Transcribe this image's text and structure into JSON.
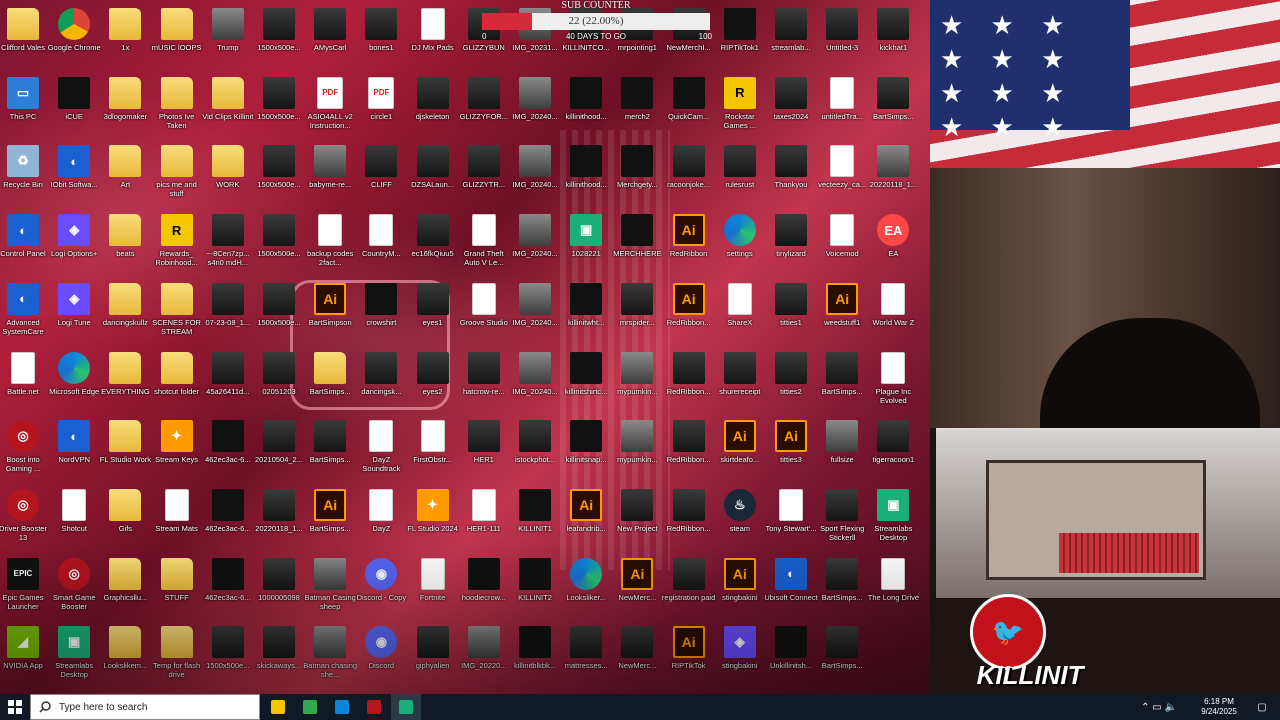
{
  "sub_counter": {
    "title": "SUB COUNTER",
    "current": 22,
    "percent_label": "22 (22.00%)",
    "progress_fraction": 0.22,
    "min_label": "0",
    "max_label": "100",
    "days_label": "40 DAYS TO GO"
  },
  "desktop_icons": [
    {
      "label": "Clifford Vales",
      "type": "folder"
    },
    {
      "label": "Google Chrome",
      "type": "chrome"
    },
    {
      "label": "1x",
      "type": "folder"
    },
    {
      "label": "mUSIC lOOPS",
      "type": "folder"
    },
    {
      "label": "Trump",
      "type": "photo"
    },
    {
      "label": "1500x500e...",
      "type": "img"
    },
    {
      "label": "AMysCarl",
      "type": "img"
    },
    {
      "label": "bones1",
      "type": "img"
    },
    {
      "label": "DJ Mix Pads",
      "type": "file"
    },
    {
      "label": "GLIZZYBUN",
      "type": "img"
    },
    {
      "label": "IMG_20231...",
      "type": "photo"
    },
    {
      "label": "KILLINITCO...",
      "type": "img"
    },
    {
      "label": "mrpointing1",
      "type": "img"
    },
    {
      "label": "NewMerchI...",
      "type": "img"
    },
    {
      "label": "RIPTikTok1",
      "type": "dark"
    },
    {
      "label": "streamlab...",
      "type": "img"
    },
    {
      "label": "Untitled-3",
      "type": "img"
    },
    {
      "label": "kickhat1",
      "type": "img"
    },
    {
      "label": "This PC",
      "type": "pc"
    },
    {
      "label": "iCUE",
      "type": "dark"
    },
    {
      "label": "3dlogomaker",
      "type": "folder"
    },
    {
      "label": "Photos Ive Taken",
      "type": "folder"
    },
    {
      "label": "Vid Clips Killinit",
      "type": "folder"
    },
    {
      "label": "1500x500e...",
      "type": "img"
    },
    {
      "label": "ASIO4ALL v2 Instruction...",
      "type": "pdf"
    },
    {
      "label": "circle1",
      "type": "pdf"
    },
    {
      "label": "djskeleton",
      "type": "img"
    },
    {
      "label": "GLIZZYFOR...",
      "type": "img"
    },
    {
      "label": "IMG_20240...",
      "type": "photo"
    },
    {
      "label": "killinithood...",
      "type": "dark"
    },
    {
      "label": "merch2",
      "type": "dark"
    },
    {
      "label": "QuickCam...",
      "type": "dark"
    },
    {
      "label": "Rockstar Games ...",
      "type": "yellow"
    },
    {
      "label": "taxes2024",
      "type": "img"
    },
    {
      "label": "untitledTra...",
      "type": "file"
    },
    {
      "label": "BartSimps...",
      "type": "img"
    },
    {
      "label": "Recycle Bin",
      "type": "recycle"
    },
    {
      "label": "IObit Softwa...",
      "type": "app"
    },
    {
      "label": "Art",
      "type": "folder"
    },
    {
      "label": "pics me and stuff",
      "type": "folder"
    },
    {
      "label": "WORK",
      "type": "folder"
    },
    {
      "label": "1500x500e...",
      "type": "img"
    },
    {
      "label": "babyme-re...",
      "type": "photo"
    },
    {
      "label": "CLIFF",
      "type": "img"
    },
    {
      "label": "DZSALaun...",
      "type": "img"
    },
    {
      "label": "GLIZZYTR...",
      "type": "img"
    },
    {
      "label": "IMG_20240...",
      "type": "photo"
    },
    {
      "label": "killinithood...",
      "type": "dark"
    },
    {
      "label": "Merchgety...",
      "type": "dark"
    },
    {
      "label": "racoonjoke...",
      "type": "img"
    },
    {
      "label": "rulesrust",
      "type": "img"
    },
    {
      "label": "Thankyou",
      "type": "img"
    },
    {
      "label": "vecteezy_ca...",
      "type": "file"
    },
    {
      "label": "20220118_1...",
      "type": "photo"
    },
    {
      "label": "Control Panel",
      "type": "app"
    },
    {
      "label": "Logi Options+",
      "type": "purple"
    },
    {
      "label": "beats",
      "type": "folder"
    },
    {
      "label": "Rewards_ Robinhood...",
      "type": "yellow"
    },
    {
      "label": "~-8Cen7zp... s4n0 mdH...",
      "type": "img"
    },
    {
      "label": "1500x500e...",
      "type": "img"
    },
    {
      "label": "backup codes 2fact...",
      "type": "file"
    },
    {
      "label": "CountryM...",
      "type": "file"
    },
    {
      "label": "ec16fkQiuu5",
      "type": "img"
    },
    {
      "label": "Grand Theft Auto V Le...",
      "type": "file"
    },
    {
      "label": "IMG_20240...",
      "type": "photo"
    },
    {
      "label": "1028221",
      "type": "green"
    },
    {
      "label": "MERCHHERE",
      "type": "dark"
    },
    {
      "label": "RedRibbon",
      "type": "ai"
    },
    {
      "label": "settings",
      "type": "edge"
    },
    {
      "label": "tinylizard",
      "type": "img"
    },
    {
      "label": "Voicemod",
      "type": "file"
    },
    {
      "label": "EA",
      "type": "ea"
    },
    {
      "label": "Advanced SystemCare",
      "type": "app"
    },
    {
      "label": "Logi Tune",
      "type": "purple"
    },
    {
      "label": "dancingskullz",
      "type": "folder"
    },
    {
      "label": "SCENES FOR STREAM",
      "type": "folder"
    },
    {
      "label": "07-23-08_1...",
      "type": "img"
    },
    {
      "label": "1500x500e...",
      "type": "img"
    },
    {
      "label": "BartSimpson",
      "type": "ai"
    },
    {
      "label": "crowshirt",
      "type": "dark"
    },
    {
      "label": "eyes1",
      "type": "img"
    },
    {
      "label": "Groove Studio",
      "type": "file"
    },
    {
      "label": "IMG_20240...",
      "type": "photo"
    },
    {
      "label": "killinitwht...",
      "type": "dark"
    },
    {
      "label": "mrspider...",
      "type": "img"
    },
    {
      "label": "RedRibbon...",
      "type": "ai"
    },
    {
      "label": "ShareX",
      "type": "file"
    },
    {
      "label": "titties1",
      "type": "img"
    },
    {
      "label": "weedstuff1",
      "type": "ai"
    },
    {
      "label": "World War Z",
      "type": "file"
    },
    {
      "label": "Battle.net",
      "type": "file"
    },
    {
      "label": "Microsoft Edge",
      "type": "edge"
    },
    {
      "label": "EVERYTHING",
      "type": "folder"
    },
    {
      "label": "shotcut folder",
      "type": "folder"
    },
    {
      "label": "45a26411d...",
      "type": "img"
    },
    {
      "label": "02051203",
      "type": "img"
    },
    {
      "label": "BartSimps...",
      "type": "folder"
    },
    {
      "label": "dancingsk...",
      "type": "img"
    },
    {
      "label": "eyes2",
      "type": "img"
    },
    {
      "label": "hatcrow-re...",
      "type": "img"
    },
    {
      "label": "IMG_20240...",
      "type": "photo"
    },
    {
      "label": "killinitshirtc...",
      "type": "dark"
    },
    {
      "label": "mypumkin...",
      "type": "photo"
    },
    {
      "label": "RedRibbon...",
      "type": "img"
    },
    {
      "label": "shurereceipt",
      "type": "img"
    },
    {
      "label": "titties2",
      "type": "img"
    },
    {
      "label": "BartSimps...",
      "type": "img"
    },
    {
      "label": "Plague Inc Evolved",
      "type": "file"
    },
    {
      "label": "Boost into Gaming ...",
      "type": "red"
    },
    {
      "label": "NordVPN",
      "type": "app"
    },
    {
      "label": "FL Studio Work",
      "type": "folder"
    },
    {
      "label": "Stream Keys",
      "type": "orange"
    },
    {
      "label": "462ec3ac-6...",
      "type": "dark"
    },
    {
      "label": "20210504_2...",
      "type": "img"
    },
    {
      "label": "BartSimps...",
      "type": "img"
    },
    {
      "label": "DayZ Soundtrack",
      "type": "file"
    },
    {
      "label": "FirstObstr...",
      "type": "file"
    },
    {
      "label": "HER1",
      "type": "img"
    },
    {
      "label": "istockphot...",
      "type": "img"
    },
    {
      "label": "killinitsnap...",
      "type": "dark"
    },
    {
      "label": "mypumkin...",
      "type": "photo"
    },
    {
      "label": "RedRibbon...",
      "type": "img"
    },
    {
      "label": "skirtdeafo...",
      "type": "ai"
    },
    {
      "label": "titties3",
      "type": "ai"
    },
    {
      "label": "fullsize",
      "type": "photo"
    },
    {
      "label": "tigerracoon1",
      "type": "img"
    },
    {
      "label": "Driver Booster 13",
      "type": "red"
    },
    {
      "label": "Shotcut",
      "type": "file"
    },
    {
      "label": "Gifs",
      "type": "folder"
    },
    {
      "label": "Stream Mats",
      "type": "file"
    },
    {
      "label": "462ec3ac-6...",
      "type": "dark"
    },
    {
      "label": "20220118_1...",
      "type": "img"
    },
    {
      "label": "BartSimps...",
      "type": "ai"
    },
    {
      "label": "DayZ",
      "type": "file"
    },
    {
      "label": "FL Studio 2024",
      "type": "orange"
    },
    {
      "label": "HER1-111",
      "type": "file"
    },
    {
      "label": "KILLINIT1",
      "type": "dark"
    },
    {
      "label": "leafandrib...",
      "type": "ai"
    },
    {
      "label": "New Project",
      "type": "img"
    },
    {
      "label": "RedRibbon...",
      "type": "img"
    },
    {
      "label": "steam",
      "type": "steam"
    },
    {
      "label": "Tony Stewart'...",
      "type": "file"
    },
    {
      "label": "Sport Flexing Stickerll",
      "type": "img"
    },
    {
      "label": "Streamlabs Desktop",
      "type": "green"
    },
    {
      "label": "Epic Games Launcher",
      "type": "epic"
    },
    {
      "label": "Smart Game Booster",
      "type": "red"
    },
    {
      "label": "Graphicsllu...",
      "type": "folder"
    },
    {
      "label": "STUFF",
      "type": "folder"
    },
    {
      "label": "462ec3ac-6...",
      "type": "dark"
    },
    {
      "label": "1000005098",
      "type": "img"
    },
    {
      "label": "Batman Casing sheep",
      "type": "photo"
    },
    {
      "label": "Discord - Copy",
      "type": "discord"
    },
    {
      "label": "Fortnite",
      "type": "file"
    },
    {
      "label": "hoodiecrow...",
      "type": "dark"
    },
    {
      "label": "KILLINIT2",
      "type": "dark"
    },
    {
      "label": "Looksliker...",
      "type": "edge"
    },
    {
      "label": "NewMerc...",
      "type": "ai"
    },
    {
      "label": "registration paid",
      "type": "img"
    },
    {
      "label": "stingbakini",
      "type": "ai"
    },
    {
      "label": "Ubisoft Connect",
      "type": "app"
    },
    {
      "label": "BartSimps...",
      "type": "img"
    },
    {
      "label": "The Long Drive",
      "type": "file"
    },
    {
      "label": "NVIDIA App",
      "type": "nvidia"
    },
    {
      "label": "Streamlabs Desktop",
      "type": "green"
    },
    {
      "label": "Lookslikem...",
      "type": "folder"
    },
    {
      "label": "Temp for flash drive",
      "type": "folder"
    },
    {
      "label": "1500x500e...",
      "type": "img"
    },
    {
      "label": "skickaways...",
      "type": "img"
    },
    {
      "label": "Batman chasing she...",
      "type": "photo"
    },
    {
      "label": "Discord",
      "type": "discord"
    },
    {
      "label": "giphyalien",
      "type": "img"
    },
    {
      "label": "IMG_20220...",
      "type": "photo"
    },
    {
      "label": "killinitblkbk...",
      "type": "dark"
    },
    {
      "label": "mattresses...",
      "type": "img"
    },
    {
      "label": "NewMerc...",
      "type": "img"
    },
    {
      "label": "RIPTikTok",
      "type": "ai"
    },
    {
      "label": "stingbakini",
      "type": "purple"
    },
    {
      "label": "Unkillinitsh...",
      "type": "dark"
    },
    {
      "label": "BartSimps...",
      "type": "img"
    },
    {
      "label": ""
    }
  ],
  "stream_overlay": {
    "flag_stars": "★ ★ ★ ★ ★ ★ ★ ★ ★ ★ ★ ★",
    "logo_text": "KILLINIT",
    "logo_emblem": "🐦"
  },
  "taskbar": {
    "start_icon": "windows-icon",
    "search_placeholder": "Type here to search",
    "clock_time": "6:18 PM",
    "clock_date": "9/24/2025",
    "tray_icons": "⌃ ▭ 🔈",
    "notification_icon": "▢",
    "pinned": [
      {
        "name": "file-explorer-icon",
        "color": "#f3c600"
      },
      {
        "name": "xbox-icon",
        "color": "#33a853"
      },
      {
        "name": "edge-icon",
        "color": "#0b84d8"
      },
      {
        "name": "obs-icon",
        "color": "#b3141e"
      },
      {
        "name": "streamlabs-icon",
        "color": "#1bb07a"
      }
    ]
  }
}
